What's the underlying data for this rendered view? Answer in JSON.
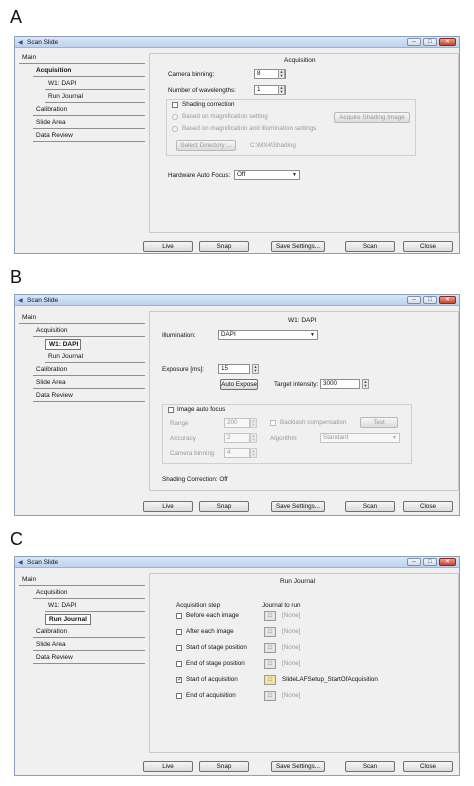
{
  "panels": {
    "a": {
      "letter": "A"
    },
    "b": {
      "letter": "B"
    },
    "c": {
      "letter": "C"
    }
  },
  "window": {
    "title": "Scan Slide",
    "minimize": "‒",
    "maximize": "□",
    "close": "✕"
  },
  "nav": {
    "main": "Main",
    "acquisition": "Acquisition",
    "w1_dapi": "W1: DAPI",
    "run_journal": "Run Journal",
    "calibration": "Calibration",
    "slide_area": "Slide Area",
    "data_review": "Data Review"
  },
  "bottom_buttons": {
    "live": "Live",
    "snap": "Snap",
    "save_settings": "Save Settings...",
    "scan": "Scan",
    "close": "Close"
  },
  "acquisition": {
    "title": "Acquisition",
    "camera_binning_label": "Camera binning:",
    "camera_binning_value": "8",
    "num_wavelengths_label": "Number of wavelengths:",
    "num_wavelengths_value": "1",
    "shading_correction_label": "Shading correction",
    "radio_magnification": "Based on magnification setting",
    "radio_mag_illumination": "Based on magnification and illumination settings",
    "acquire_shading_button": "Acquire Shading Image",
    "select_directory_button": "Select Directory ...",
    "directory_path": "C:\\MX4\\Shading",
    "autofocus_label": "Hardware Auto Focus:",
    "autofocus_value": "Off"
  },
  "w1": {
    "title": "W1: DAPI",
    "illumination_label": "Illumination:",
    "illumination_value": "DAPI",
    "exposure_label": "Exposure [ms]:",
    "exposure_value": "15",
    "auto_expose_button": "Auto Expose",
    "target_intensity_label": "Target intensity:",
    "target_intensity_value": "3000",
    "image_autofocus_label": "Image auto focus",
    "range_label": "Range",
    "range_value": "200",
    "accuracy_label": "Accuracy",
    "accuracy_value": "2",
    "camera_binning_label": "Camera binning",
    "camera_binning_value": "4",
    "backlash_label": "Backlash compensation",
    "test_button": "Test",
    "algorithm_label": "Algorithm",
    "algorithm_value": "Standard",
    "shading_status": "Shading Correction: Off"
  },
  "journal": {
    "title": "Run Journal",
    "col_step": "Acquisition step",
    "col_journal": "Journal to run",
    "rows": [
      {
        "step": "Before each image",
        "journal": "[None]",
        "checked": false
      },
      {
        "step": "After each image",
        "journal": "[None]",
        "checked": false
      },
      {
        "step": "Start of stage position",
        "journal": "[None]",
        "checked": false
      },
      {
        "step": "End of stage position",
        "journal": "[None]",
        "checked": false
      },
      {
        "step": "Start of acquisition",
        "journal": "SlideLAFSetup_StartOfAcquisition",
        "checked": true
      },
      {
        "step": "End of acquisition",
        "journal": "[None]",
        "checked": false
      }
    ]
  }
}
